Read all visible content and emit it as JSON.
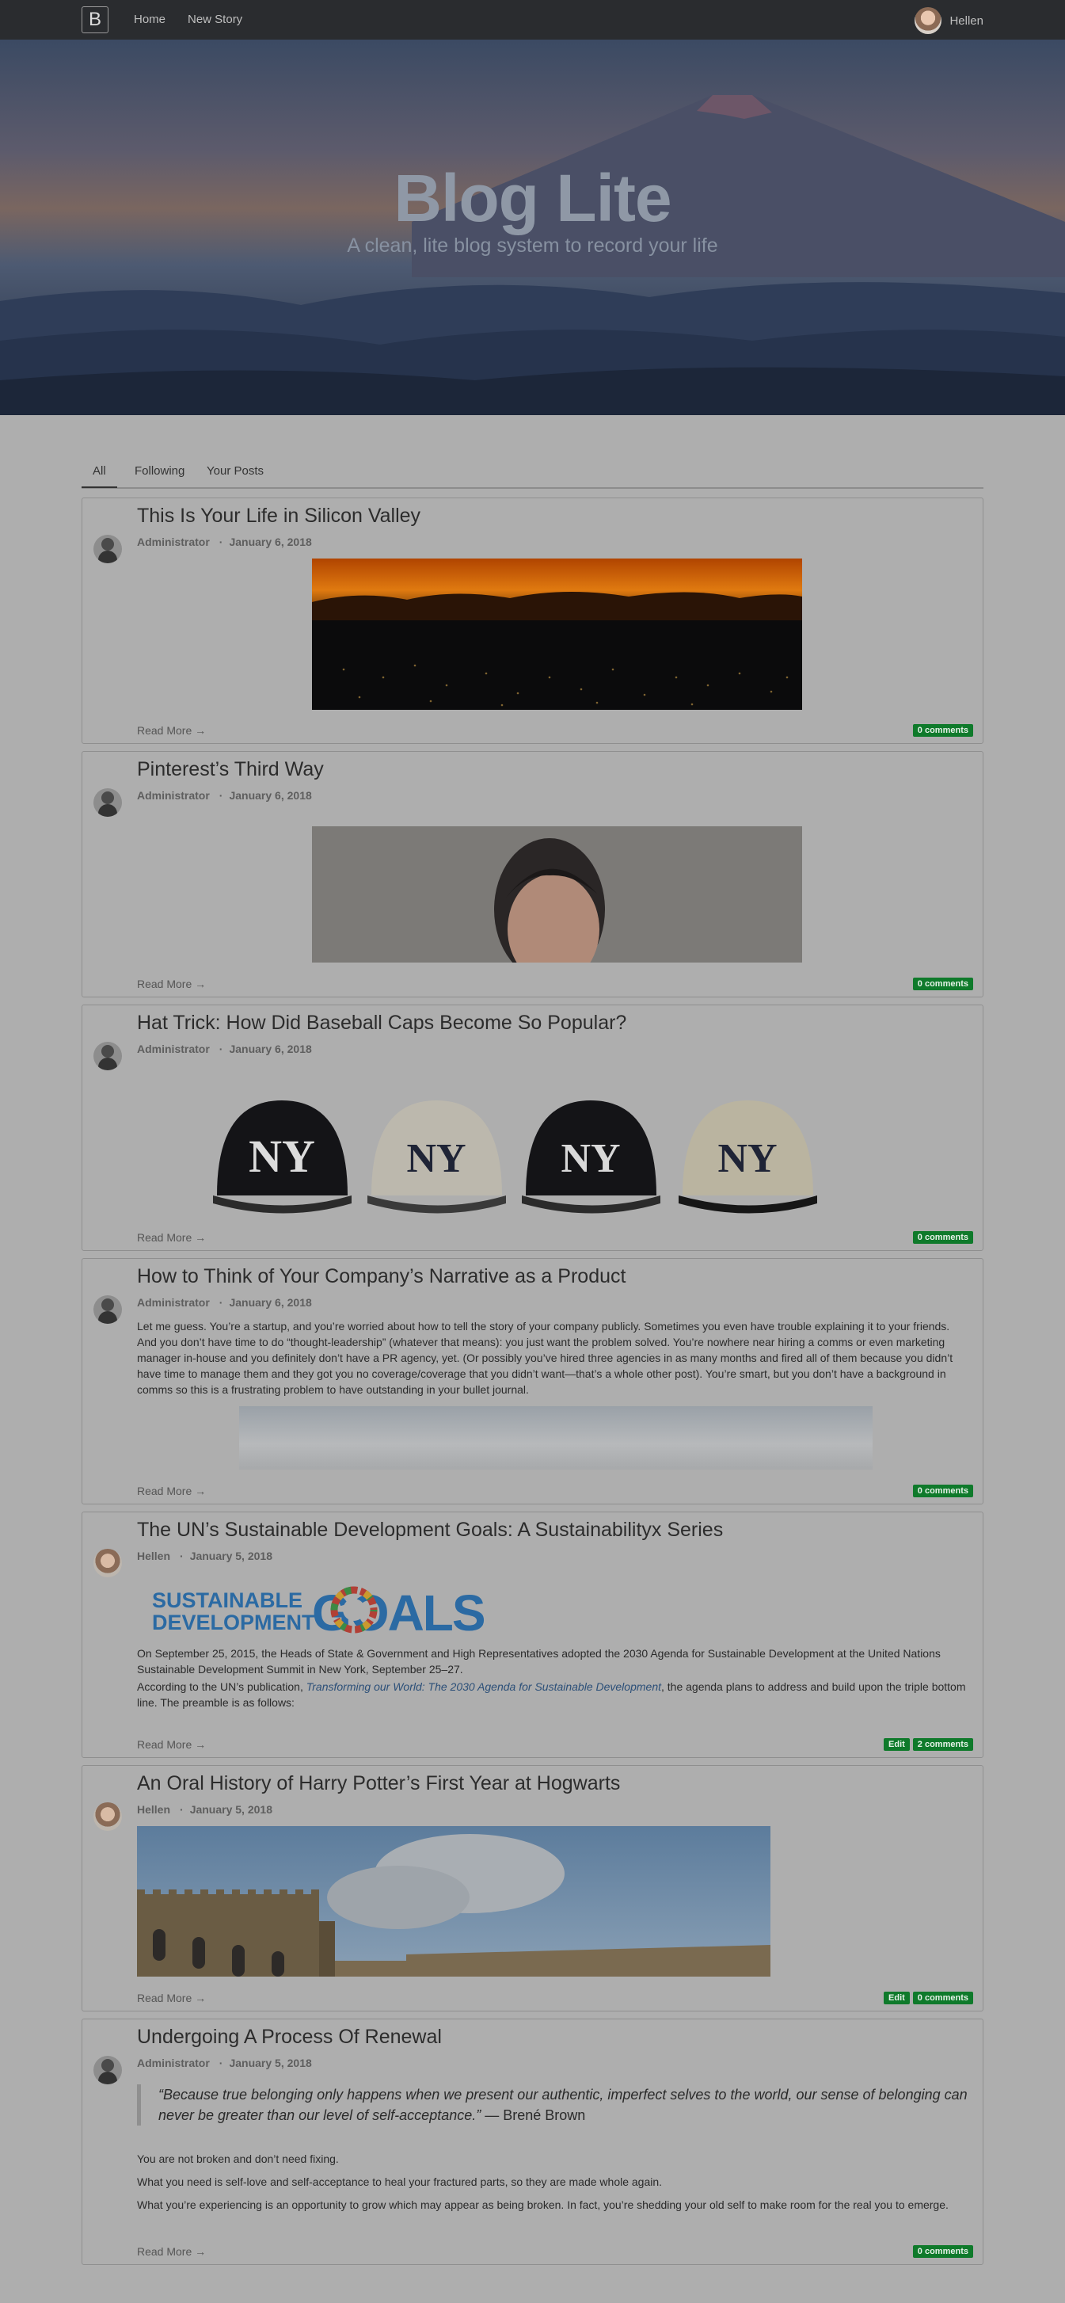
{
  "nav": {
    "brand": "B",
    "links": [
      "Home",
      "New Story"
    ],
    "user": "Hellen"
  },
  "hero": {
    "title": "Blog Lite",
    "subtitle": "A clean, lite blog system to record your life"
  },
  "tabs": [
    "All",
    "Following",
    "Your Posts"
  ],
  "read_more": "Read More →",
  "edit_label": "Edit",
  "posts": [
    {
      "title": "This Is Your Life in Silicon Valley",
      "author": "Administrator",
      "date": "January 6, 2018",
      "comments": "0 comments"
    },
    {
      "title": "Pinterest’s Third Way",
      "author": "Administrator",
      "date": "January 6, 2018",
      "comments": "0 comments"
    },
    {
      "title": "Hat Trick: How Did Baseball Caps Become So Popular?",
      "author": "Administrator",
      "date": "January 6, 2018",
      "comments": "0 comments",
      "cap_logos": [
        "NY",
        "NY",
        "NY",
        "NY"
      ]
    },
    {
      "title": "How to Think of Your Company’s Narrative as a Product",
      "author": "Administrator",
      "date": "January 6, 2018",
      "comments": "0 comments",
      "excerpt": "Let me guess. You’re a startup, and you’re worried about how to tell the story of your company publicly. Sometimes you even have trouble explaining it to your friends. And you don’t have time to do “thought-leadership” (whatever that means): you just want the problem solved. You’re nowhere near hiring a comms or even marketing manager in-house and you definitely don’t have a PR agency, yet. (Or possibly you’ve hired three agencies in as many months and fired all of them because you didn’t have time to manage them and they got you no coverage/coverage that you didn’t want—that’s a whole other post). You’re smart, but you don’t have a background in comms so this is a frustrating problem to have outstanding in your bullet journal."
    },
    {
      "title": "The UN’s Sustainable Development Goals: A Sustainabilityx Series",
      "author": "Hellen",
      "date": "January 5, 2018",
      "comments": "2 comments",
      "sdg_line1": "SUSTAINABLE",
      "sdg_line2": "DEVELOPMENT",
      "sdg_goals": "GOALS",
      "para1": "On September 25, 2015, the Heads of State & Government and High Representatives adopted the 2030 Agenda for Sustainable Development at the United Nations Sustainable Development Summit in New York, September 25–27.",
      "para2_before": "According to the UN’s publication, ",
      "para2_link": "Transforming our World: The 2030 Agenda for Sustainable Development",
      "para2_after": ", the agenda plans to address and build upon the triple bottom line. The preamble is as follows:"
    },
    {
      "title": "An Oral History of Harry Potter’s First Year at Hogwarts",
      "author": "Hellen",
      "date": "January 5, 2018",
      "comments": "0 comments"
    },
    {
      "title": "Undergoing A Process Of Renewal",
      "author": "Administrator",
      "date": "January 5, 2018",
      "comments": "0 comments",
      "quote": "“Because true belonging only happens when we present our authentic, imperfect selves to the world, our sense of belonging can never be greater than our level of self-acceptance.”",
      "quote_author": " — Brené Brown",
      "lines": [
        "You are not broken and don’t need fixing.",
        "What you need is self-love and self-acceptance to heal your fractured parts, so they are made whole again.",
        "What you’re experiencing is an opportunity to grow which may appear as being broken. In fact, you’re shedding your old self to make room for the real you to emerge."
      ]
    }
  ],
  "colors": {
    "navbar": "#2a2c2f",
    "page_overlay": "#aeaeae",
    "badge": "#0f7a2b",
    "link": "#2b4f78"
  }
}
